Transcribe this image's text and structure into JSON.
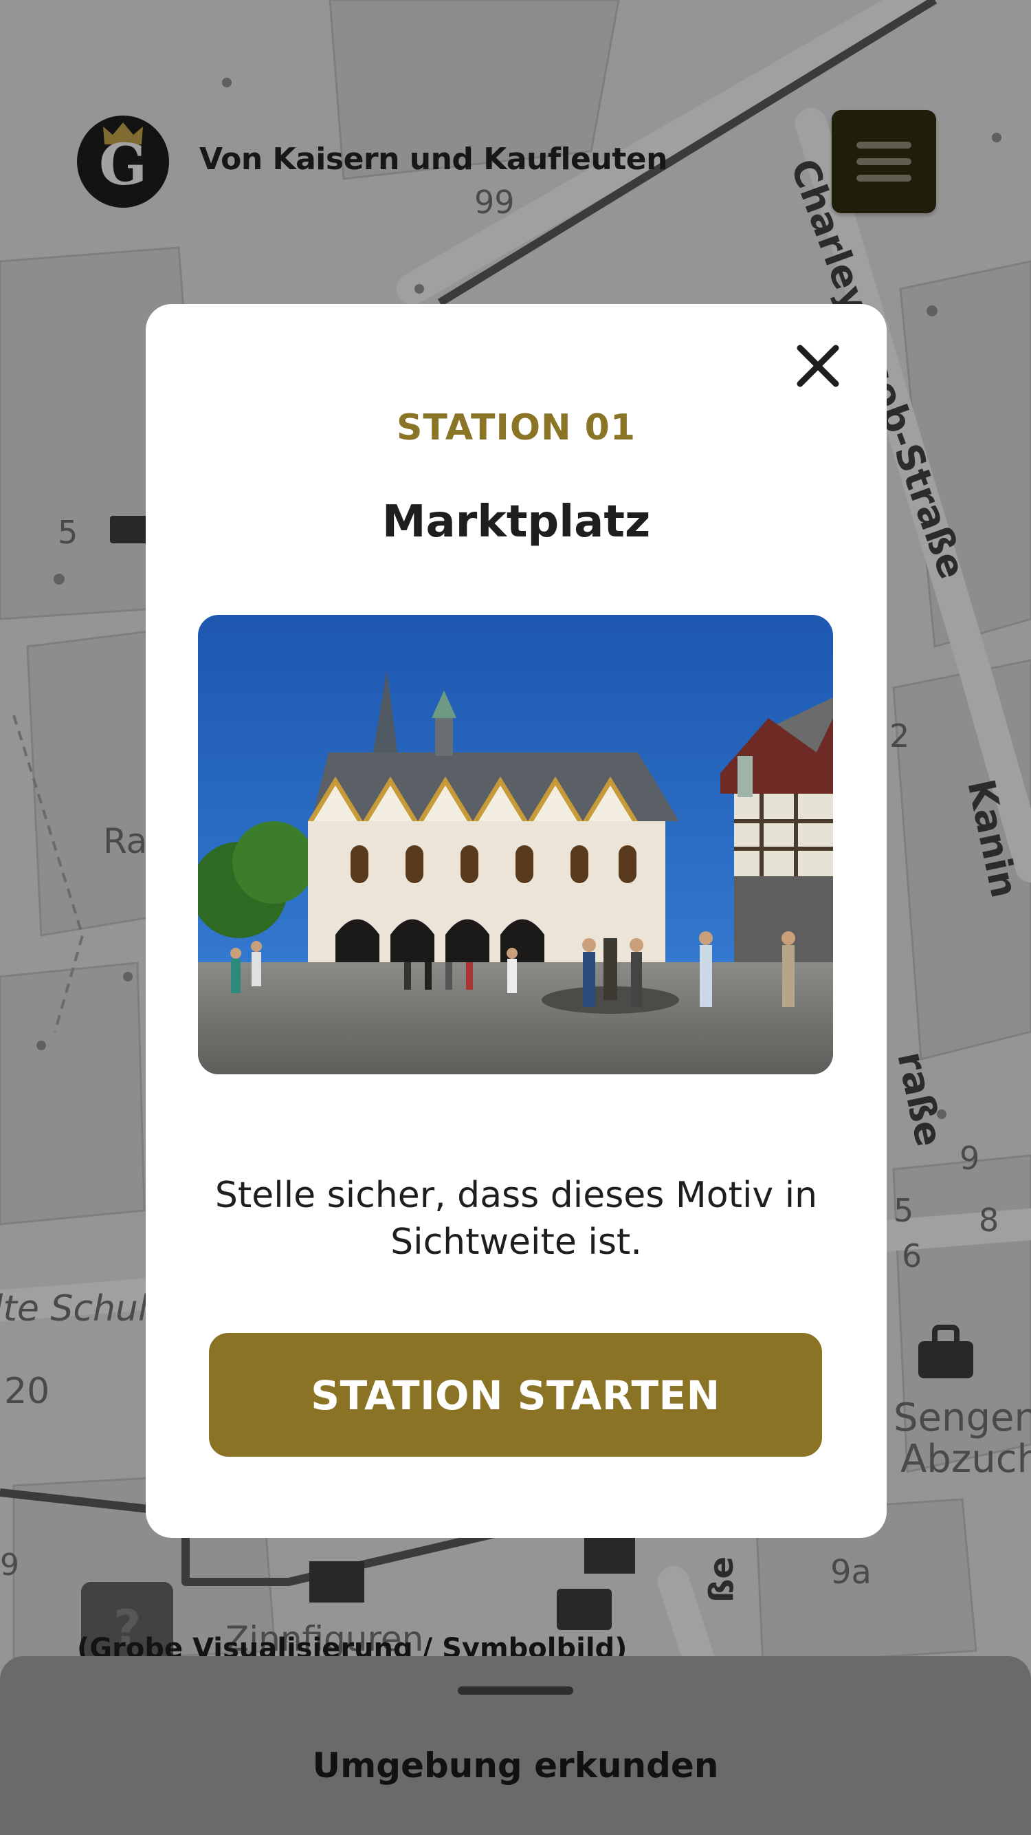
{
  "header": {
    "logo_letter": "G",
    "title": "Von Kaisern und Kaufleuten"
  },
  "map": {
    "labels": [
      {
        "text": "Charley-Jacob-Straße"
      },
      {
        "text": "Kanin"
      },
      {
        "text": "raße"
      },
      {
        "text": "lte Schul"
      },
      {
        "text": "Zinnfiguren"
      },
      {
        "text": "Sengen"
      },
      {
        "text": "Abzuch"
      },
      {
        "text": "ße"
      },
      {
        "text": "99"
      },
      {
        "text": "5"
      },
      {
        "text": "20"
      },
      {
        "text": "9"
      },
      {
        "text": "8"
      },
      {
        "text": "5"
      },
      {
        "text": "6"
      },
      {
        "text": "9a"
      },
      {
        "text": "2"
      },
      {
        "text": "Ra"
      },
      {
        "text": "9"
      }
    ]
  },
  "modal": {
    "station_number": "STATION 01",
    "station_title": "Marktplatz",
    "photo_alt": "Marktplatz",
    "hint": "Stelle sicher, dass dieses Motiv in Sichtweite ist.",
    "start_button": "STATION STARTEN"
  },
  "sheet": {
    "caption_behind": "(Grobe Visualisierung / Symbolbild)",
    "help_label": "?",
    "label": "Umgebung erkunden"
  },
  "colors": {
    "accent": "#8a7325",
    "menu_button": "#2e2a10",
    "modal_background": "#ffffff",
    "overlay": "rgba(0,0,0,0.30)"
  }
}
